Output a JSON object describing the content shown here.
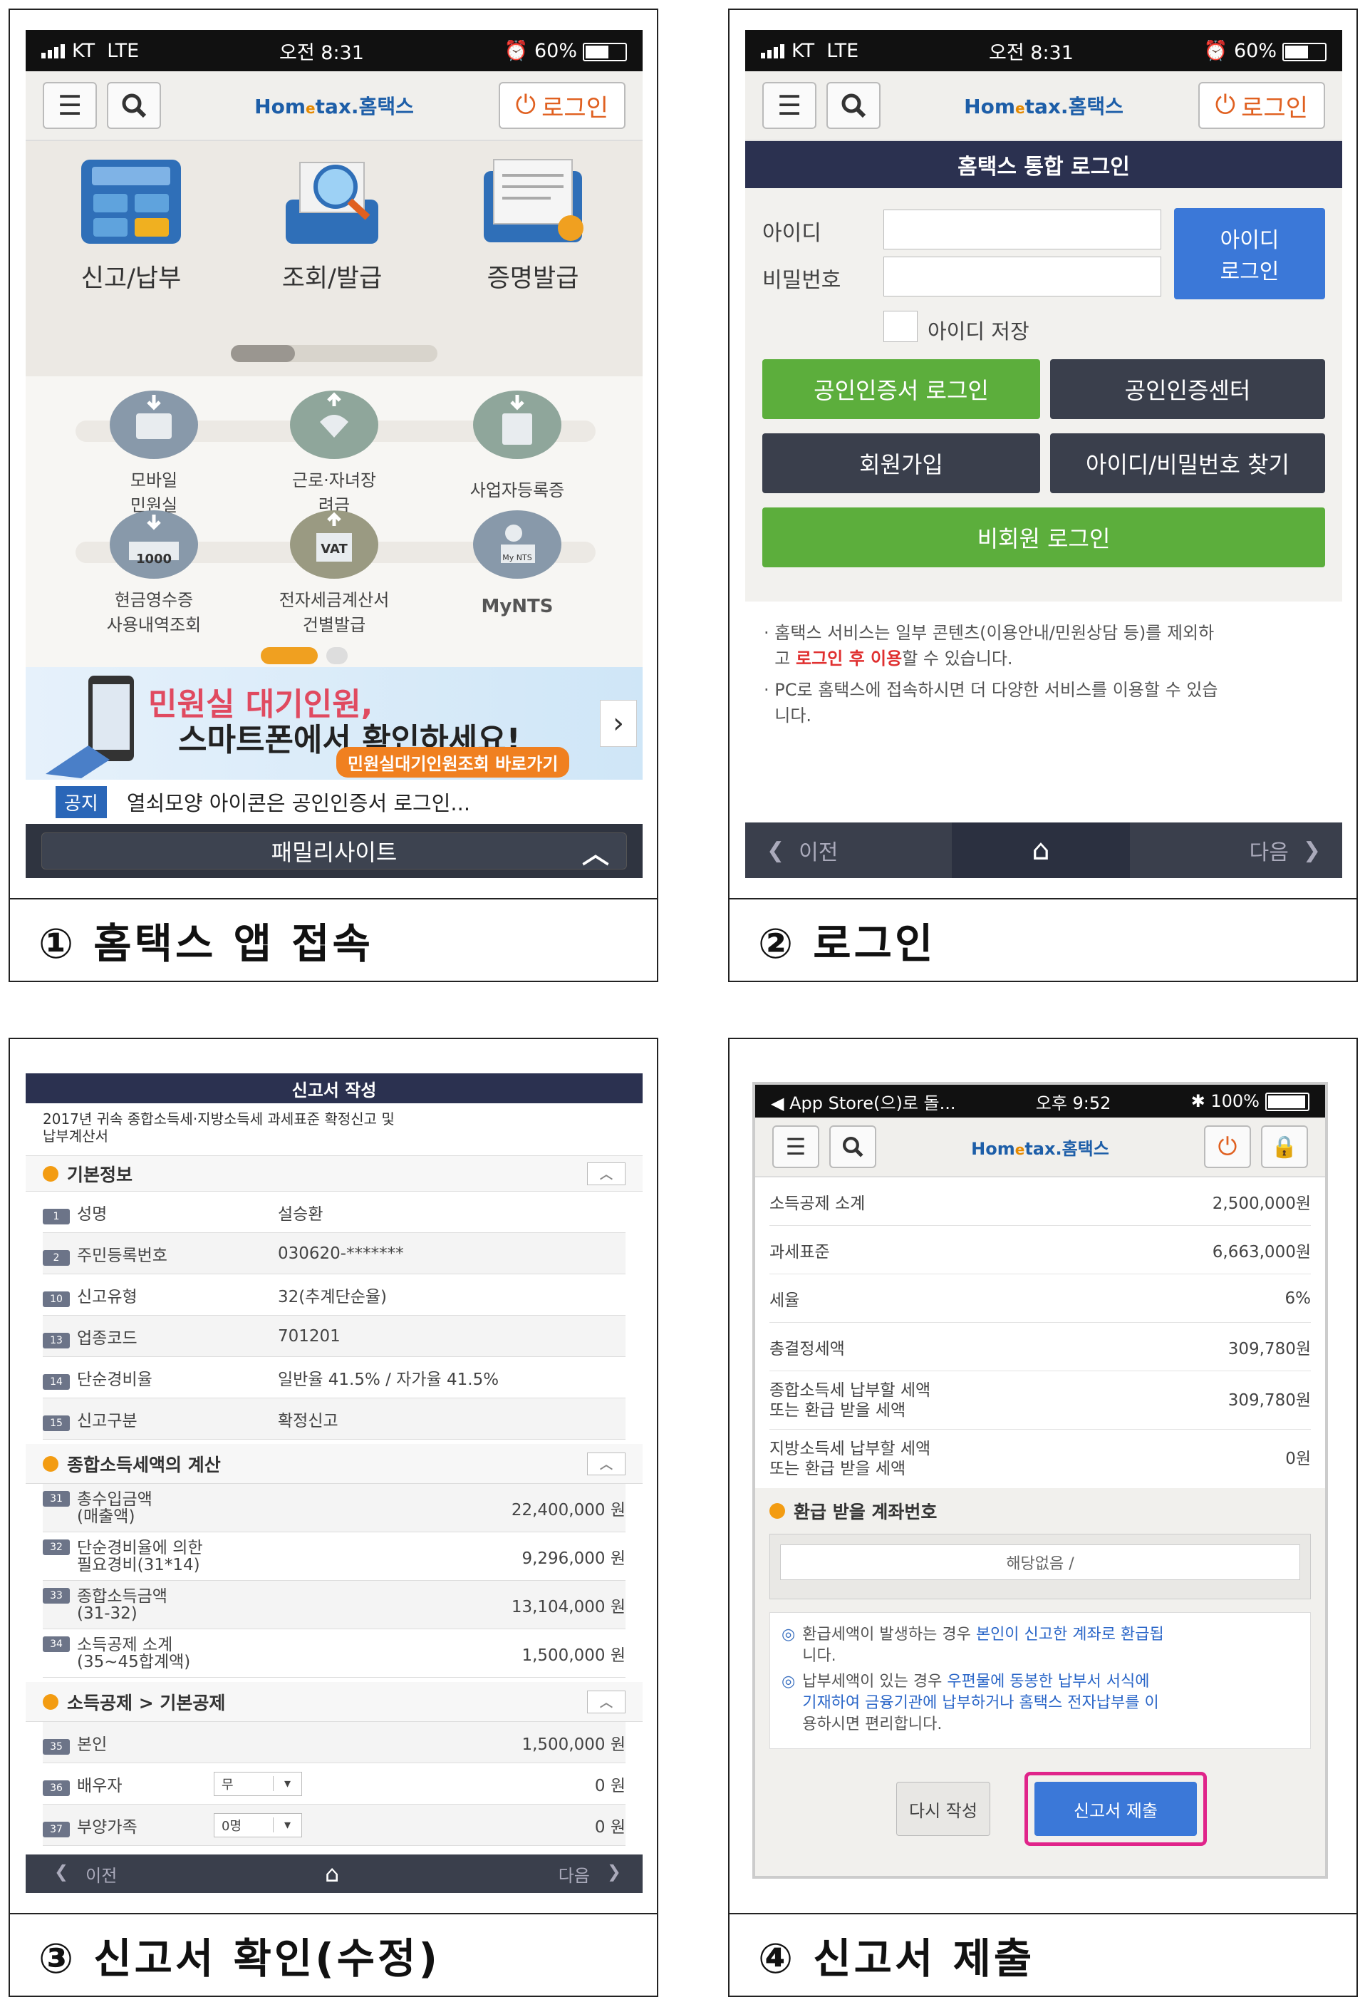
{
  "captions": {
    "p1": "① 홈택스 앱 접속",
    "p2": "② 로그인",
    "p3": "③ 신고서 확인(수정)",
    "p4": "④ 신고서 제출"
  },
  "p1": {
    "carrier": "KT",
    "network": "LTE",
    "time": "오전 8:31",
    "battery": "60%",
    "logo_a": "Hom",
    "logo_b": "e",
    "logo_c": "tax",
    "logo_d": "홈택스",
    "login_label": "로그인",
    "top_icons": [
      "신고/납부",
      "조회/발급",
      "증명발급"
    ],
    "services": [
      {
        "l1": "모바일",
        "l2": "민원실"
      },
      {
        "l1": "근로·자녀장",
        "l2": "려금"
      },
      {
        "l1": "사업자등록증",
        "l2": ""
      },
      {
        "l1": "현금영수증",
        "l2": "사용내역조회"
      },
      {
        "l1": "전자세금계산서",
        "l2": "건별발급"
      },
      {
        "l1": "MyNTS",
        "l2": ""
      }
    ],
    "icon_badges": {
      "vat": "VAT",
      "cash": "1000",
      "mynts": "My NTS"
    },
    "banner_title": "민원실 대기인원,",
    "banner_sub": "스마트폰에서 확인하세요!",
    "banner_link": "민원실대기인원조회 바로가기",
    "banner_next": "›",
    "notice_tag": "공지",
    "notice_text": "열쇠모양 아이콘은 공인인증서 로그인...",
    "family_label": "패밀리사이트"
  },
  "p2": {
    "carrier": "KT",
    "network": "LTE",
    "time": "오전 8:31",
    "battery": "60%",
    "login_label": "로그인",
    "title": "홈택스 통합 로그인",
    "id_label": "아이디",
    "pw_label": "비밀번호",
    "id_login_l1": "아이디",
    "id_login_l2": "로그인",
    "save_id": "아이디 저장",
    "cert_login": "공인인증서 로그인",
    "cert_center": "공인인증센터",
    "join": "회원가입",
    "find": "아이디/비밀번호 찾기",
    "guest": "비회원 로그인",
    "note1_a": "홈택스 서비스는 일부 콘텐츠(이용안내/민원상담 등)를 제외하",
    "note1_b": "고 ",
    "note1_hl": "로그인 후 이용",
    "note1_c": "할 수 있습니다.",
    "note2_a": "PC로 홈택스에 접속하시면 더 다양한 서비스를 이용할 수 있습",
    "note2_b": "니다.",
    "prev": "이전",
    "next": "다음"
  },
  "p3": {
    "title": "신고서 작성",
    "doc_title_1": "2017년 귀속 종합소득세·지방소득세 과세표준 확정신고 및",
    "doc_title_2": "납부계산서",
    "sec1": "기본정보",
    "basic": [
      {
        "n": "1",
        "label": "성명",
        "value": "설승환"
      },
      {
        "n": "2",
        "label": "주민등록번호",
        "value": "030620-*******"
      },
      {
        "n": "10",
        "label": "신고유형",
        "value": "32(추계단순율)"
      },
      {
        "n": "13",
        "label": "업종코드",
        "value": "701201"
      },
      {
        "n": "14",
        "label": "단순경비율",
        "value": "일반율 41.5% / 자가율 41.5%"
      },
      {
        "n": "15",
        "label": "신고구분",
        "value": "확정신고"
      }
    ],
    "sec2": "종합소득세액의 계산",
    "calc": [
      {
        "n": "31",
        "l1": "총수입금액",
        "l2": "(매출액)",
        "value": "22,400,000 원"
      },
      {
        "n": "32",
        "l1": "단순경비율에 의한",
        "l2": "필요경비(31*14)",
        "value": "9,296,000 원"
      },
      {
        "n": "33",
        "l1": "종합소득금액",
        "l2": "(31-32)",
        "value": "13,104,000 원"
      },
      {
        "n": "34",
        "l1": "소득공제 소계",
        "l2": "(35~45합계액)",
        "value": "1,500,000 원"
      }
    ],
    "sec3": "소득공제 > 기본공제",
    "deduct": [
      {
        "n": "35",
        "label": "본인",
        "select": "",
        "value": "1,500,000 원"
      },
      {
        "n": "36",
        "label": "배우자",
        "select": "무",
        "value": "0 원"
      },
      {
        "n": "37",
        "label": "부양가족",
        "select": "0명",
        "value": "0 원"
      }
    ],
    "prev": "이전",
    "next": "다음"
  },
  "p4": {
    "back_app": "◀ App Store(으)로 돌...",
    "time": "오후 9:52",
    "battery": "100%",
    "rows": [
      {
        "label": "소득공제 소계",
        "label2": "",
        "value": "2,500,000원"
      },
      {
        "label": "과세표준",
        "label2": "",
        "value": "6,663,000원"
      },
      {
        "label": "세율",
        "label2": "",
        "value": "6%"
      },
      {
        "label": "총결정세액",
        "label2": "",
        "value": "309,780원"
      },
      {
        "label": "종합소득세 납부할 세액",
        "label2": "또는 환급 받을 세액",
        "value": "309,780원"
      },
      {
        "label": "지방소득세 납부할 세액",
        "label2": "또는 환급 받을 세액",
        "value": "0원"
      }
    ],
    "refund_title": "환급 받을 계좌번호",
    "refund_value": "해당없음 /",
    "info1_a": "환급세액이 발생하는 경우 ",
    "info1_hl": "본인이 신고한 계좌로 환급됩",
    "info1_b": "니다.",
    "info2_a": "납부세액이 있는 경우 ",
    "info2_hl": "우편물에 동봉한 납부서 서식에",
    "info2_hl2": "기재하여 금융기관에 납부하거나 홈택스 전자납부를 이",
    "info2_b": "용하시면 편리합니다.",
    "rewrite": "다시 작성",
    "submit": "신고서 제출"
  }
}
